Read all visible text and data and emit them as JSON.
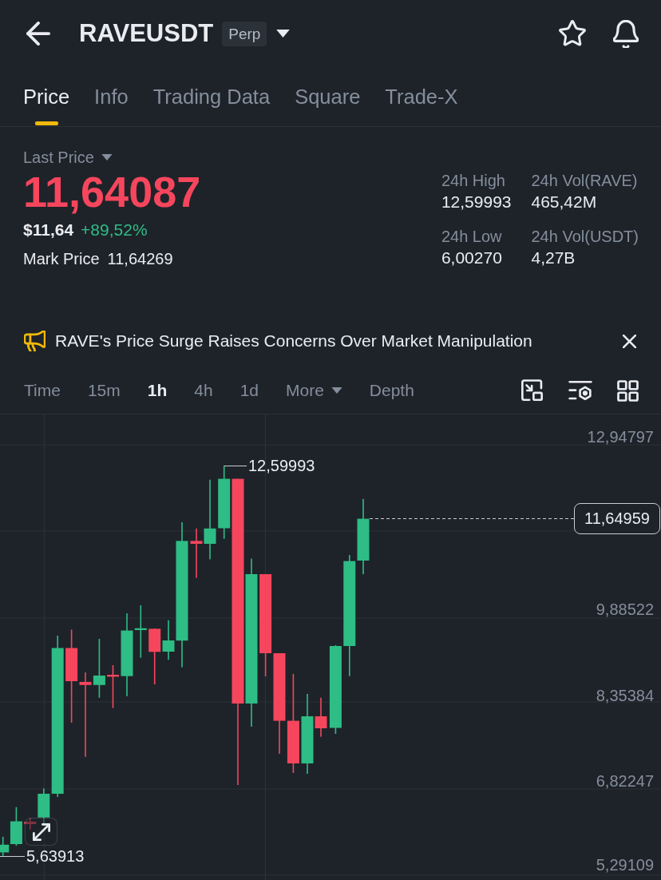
{
  "header": {
    "symbol": "RAVEUSDT",
    "contract_badge": "Perp"
  },
  "tabs": [
    {
      "label": "Price",
      "selected": true
    },
    {
      "label": "Info",
      "selected": false
    },
    {
      "label": "Trading Data",
      "selected": false
    },
    {
      "label": "Square",
      "selected": false
    },
    {
      "label": "Trade-X",
      "selected": false
    }
  ],
  "ticker": {
    "label": "Last Price",
    "last_price": "11,64087",
    "last_price_falling": true,
    "fiat_price": "$11,64",
    "change": "+89,52%",
    "change_rising": true,
    "mark_price_label": "Mark Price",
    "mark_price": "11,64269"
  },
  "stats": [
    {
      "label": "24h High",
      "value": "12,59993"
    },
    {
      "label": "24h Vol(RAVE)",
      "value": "465,42M"
    },
    {
      "label": "24h Low",
      "value": "6,00270"
    },
    {
      "label": "24h Vol(USDT)",
      "value": "4,27B"
    }
  ],
  "announcement": {
    "text": "RAVE's Price Surge Raises Concerns Over Market Manipulation"
  },
  "intervals": [
    {
      "label": "Time",
      "selected": false,
      "kind": "option"
    },
    {
      "label": "15m",
      "selected": false,
      "kind": "option"
    },
    {
      "label": "1h",
      "selected": true,
      "kind": "option"
    },
    {
      "label": "4h",
      "selected": false,
      "kind": "option"
    },
    {
      "label": "1d",
      "selected": false,
      "kind": "option"
    },
    {
      "label": "More",
      "selected": false,
      "kind": "menu"
    },
    {
      "label": "Depth",
      "selected": false,
      "kind": "option"
    }
  ],
  "chart": {
    "price_axis": [
      "12,94797",
      "9,88522",
      "8,35384",
      "6,82247",
      "5,29109"
    ],
    "high_label": "12,59993",
    "low_label": "5,63913",
    "current_price": "11,64959"
  }
}
